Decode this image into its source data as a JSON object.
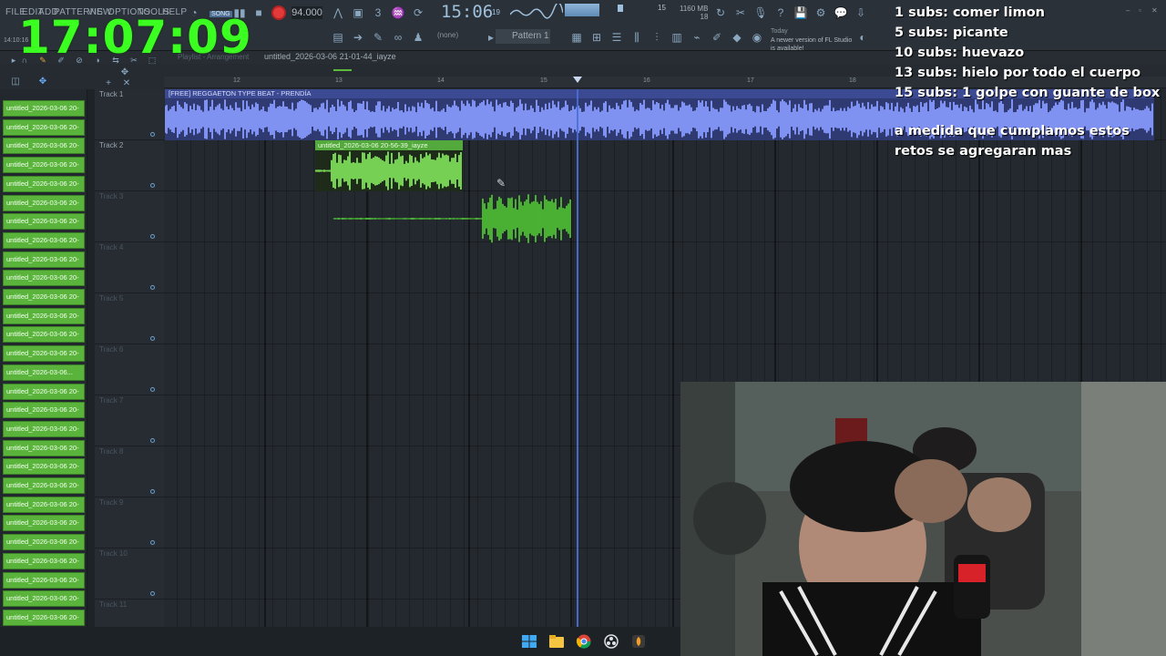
{
  "window": {
    "title": "FL Studio"
  },
  "menu": [
    "FILE",
    "EDIT",
    "ADD",
    "PATTERNS",
    "VIEW",
    "OPTIONS",
    "TOOLS",
    "HELP"
  ],
  "transport": {
    "song_label": "SONG",
    "tempo": "94.000",
    "song_time": "15:06",
    "song_time_sub": "19",
    "cpu": "15",
    "ram": "1160 MB",
    "ram_sub": "18"
  },
  "toolbar": {
    "none_label": "(none)",
    "pattern_label": "Pattern 1",
    "hint_date": "Today",
    "hint_text": "A newer version of FL Studio is available!"
  },
  "overlay": {
    "clock": "17:07:09",
    "time_small": "14:10:16",
    "subs": [
      "1 subs: comer limon",
      "5 subs: picante",
      "10 subs: huevazo",
      "13 subs: hielo por todo el cuerpo",
      "15 subs: 1 golpe con guante de box"
    ],
    "subs_note": "a medida que cumplamos estos retos se agregaran mas"
  },
  "playlist": {
    "tab": "Playlist - Arrangement",
    "title": "untitled_2026-03-06 21-01-44_iayze",
    "bar_numbers": [
      "12",
      "13",
      "14",
      "15",
      "16",
      "17",
      "18"
    ]
  },
  "picker": {
    "items": [
      "untitled_2026-03-06 20-",
      "untitled_2026-03-06 20-",
      "untitled_2026-03-06 20-",
      "untitled_2026-03-06 20-",
      "untitled_2026-03-06 20-",
      "untitled_2026-03-06 20-",
      "untitled_2026-03-06 20-",
      "untitled_2026-03-06 20-",
      "untitled_2026-03-06 20-",
      "untitled_2026-03-06 20-",
      "untitled_2026-03-06 20-",
      "untitled_2026-03-06 20-",
      "untitled_2026-03-06 20-",
      "untitled_2026-03-06 20-",
      "untitled_2026-03-06...",
      "untitled_2026-03-06 20-",
      "untitled_2026-03-06 20-",
      "untitled_2026-03-06 20-",
      "untitled_2026-03-06 20-",
      "untitled_2026-03-06 20-",
      "untitled_2026-03-06 20-",
      "untitled_2026-03-06 20-",
      "untitled_2026-03-06 20-",
      "untitled_2026-03-06 20-",
      "untitled_2026-03-06 20-",
      "untitled_2026-03-06 20-",
      "untitled_2026-03-06 20-",
      "untitled_2026-03-06 20-"
    ]
  },
  "tracks": [
    {
      "label": "Track 1",
      "dim": false
    },
    {
      "label": "Track 2",
      "dim": false
    },
    {
      "label": "Track 3",
      "dim": true
    },
    {
      "label": "Track 4",
      "dim": true
    },
    {
      "label": "Track 5",
      "dim": true
    },
    {
      "label": "Track 6",
      "dim": true
    },
    {
      "label": "Track 7",
      "dim": true
    },
    {
      "label": "Track 8",
      "dim": true
    },
    {
      "label": "Track 9",
      "dim": true
    },
    {
      "label": "Track 10",
      "dim": true
    },
    {
      "label": "Track 11",
      "dim": true
    }
  ],
  "clips": {
    "beat": "[FREE] REGGAETON TYPE BEAT - PRENDÍA",
    "vocal": "untitled_2026-03-06 20-56-39_iayze"
  },
  "colors": {
    "clock": "#3bff21",
    "beat_clip": "#8a9cff",
    "vocal_clip": "#7fe35a",
    "picker_item": "#5ab43c",
    "playhead": "#4a6fd8"
  },
  "icons": {
    "taskbar": [
      "windows-start-icon",
      "file-explorer-icon",
      "chrome-icon",
      "obs-icon",
      "fl-studio-icon"
    ]
  }
}
